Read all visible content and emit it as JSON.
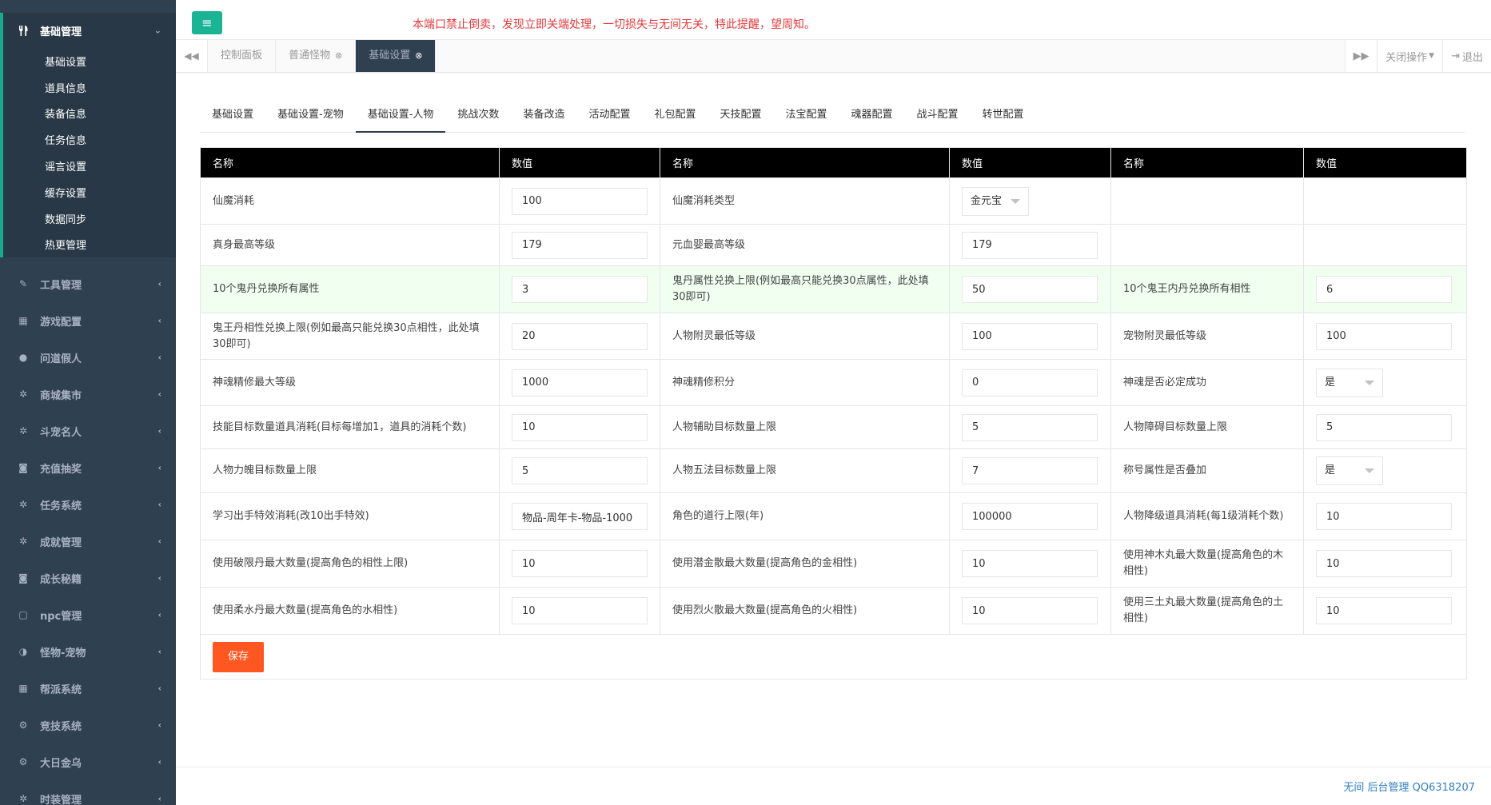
{
  "sidebar": {
    "active_group": {
      "label": "基础管理",
      "items": [
        "基础设置",
        "道具信息",
        "装备信息",
        "任务信息",
        "谣言设置",
        "缓存设置",
        "数据同步",
        "热更管理"
      ]
    },
    "groups": [
      {
        "label": "工具管理",
        "icon": "wrench-icon"
      },
      {
        "label": "游戏配置",
        "icon": "grid-icon"
      },
      {
        "label": "问道假人",
        "icon": "user-icon"
      },
      {
        "label": "商城集市",
        "icon": "gear-icon"
      },
      {
        "label": "斗宠名人",
        "icon": "gear-icon"
      },
      {
        "label": "充值抽奖",
        "icon": "camera-icon"
      },
      {
        "label": "任务系统",
        "icon": "gear-icon"
      },
      {
        "label": "成就管理",
        "icon": "gear-icon"
      },
      {
        "label": "成长秘籍",
        "icon": "camera-icon"
      },
      {
        "label": "npc管理",
        "icon": "square-icon"
      },
      {
        "label": "怪物-宠物",
        "icon": "contrast-icon"
      },
      {
        "label": "帮派系统",
        "icon": "grid-icon"
      },
      {
        "label": "竞技系统",
        "icon": "gears-icon"
      },
      {
        "label": "大日金乌",
        "icon": "gears-icon"
      },
      {
        "label": "时装管理",
        "icon": "gear-icon"
      }
    ]
  },
  "topbar": {
    "notice": "本端口禁止倒卖，发现立即关端处理，一切损失与无间无关，特此提醒，望周知。"
  },
  "tabs": [
    {
      "label": "控制面板",
      "closable": false,
      "active": false
    },
    {
      "label": "普通怪物",
      "closable": true,
      "active": false
    },
    {
      "label": "基础设置",
      "closable": true,
      "active": true
    }
  ],
  "tab_ops": {
    "close_ops": "关闭操作",
    "logout": "退出"
  },
  "subtabs": [
    "基础设置",
    "基础设置-宠物",
    "基础设置-人物",
    "挑战次数",
    "装备改造",
    "活动配置",
    "礼包配置",
    "天技配置",
    "法宝配置",
    "魂器配置",
    "战斗配置",
    "转世配置"
  ],
  "active_subtab": 2,
  "table": {
    "headers": [
      "名称",
      "数值",
      "名称",
      "数值",
      "名称",
      "数值"
    ],
    "row0": {
      "c1": "仙魔消耗",
      "v1": "100",
      "c2": "仙魔消耗类型",
      "v2": "金元宝"
    },
    "row1": {
      "c1": "真身最高等级",
      "v1": "179",
      "c2": "元血婴最高等级",
      "v2": "179"
    },
    "row2": {
      "c1": "10个鬼丹兑换所有属性",
      "v1": "3",
      "c2": "鬼丹属性兑换上限(例如最高只能兑换30点属性，此处填30即可)",
      "v2": "50",
      "c3": "10个鬼王内丹兑换所有相性",
      "v3": "6"
    },
    "row3": {
      "c1": "鬼王丹相性兑换上限(例如最高只能兑换30点相性，此处填30即可)",
      "v1": "20",
      "c2": "人物附灵最低等级",
      "v2": "100",
      "c3": "宠物附灵最低等级",
      "v3": "100"
    },
    "row4": {
      "c1": "神魂精修最大等级",
      "v1": "1000",
      "c2": "神魂精修积分",
      "v2": "0",
      "c3": "神魂是否必定成功",
      "v3": "是"
    },
    "row5": {
      "c1": "技能目标数量道具消耗(目标每增加1，道具的消耗个数)",
      "v1": "10",
      "c2": "人物辅助目标数量上限",
      "v2": "5",
      "c3": "人物障碍目标数量上限",
      "v3": "5"
    },
    "row6": {
      "c1": "人物力魄目标数量上限",
      "v1": "5",
      "c2": "人物五法目标数量上限",
      "v2": "7",
      "c3": "称号属性是否叠加",
      "v3": "是"
    },
    "row7": {
      "c1": "学习出手特效消耗(改10出手特效)",
      "v1": "物品-周年卡-物品-1000",
      "c2": "角色的道行上限(年)",
      "v2": "100000",
      "c3": "人物降级道具消耗(每1级消耗个数)",
      "v3": "10"
    },
    "row8": {
      "c1": "使用破限丹最大数量(提高角色的相性上限)",
      "v1": "10",
      "c2": "使用潜金散最大数量(提高角色的金相性)",
      "v2": "10",
      "c3": "使用神木丸最大数量(提高角色的木相性)",
      "v3": "10"
    },
    "row9": {
      "c1": "使用柔水丹最大数量(提高角色的水相性)",
      "v1": "10",
      "c2": "使用烈火散最大数量(提高角色的火相性)",
      "v2": "10",
      "c3": "使用三土丸最大数量(提高角色的土相性)",
      "v3": "10"
    }
  },
  "save_label": "保存",
  "footer": "无间 后台管理 QQ6318207",
  "colors": {
    "sidebar": "#2f4050",
    "accent": "#1ab394",
    "save": "#ff5722",
    "notice": "#e4393c"
  }
}
